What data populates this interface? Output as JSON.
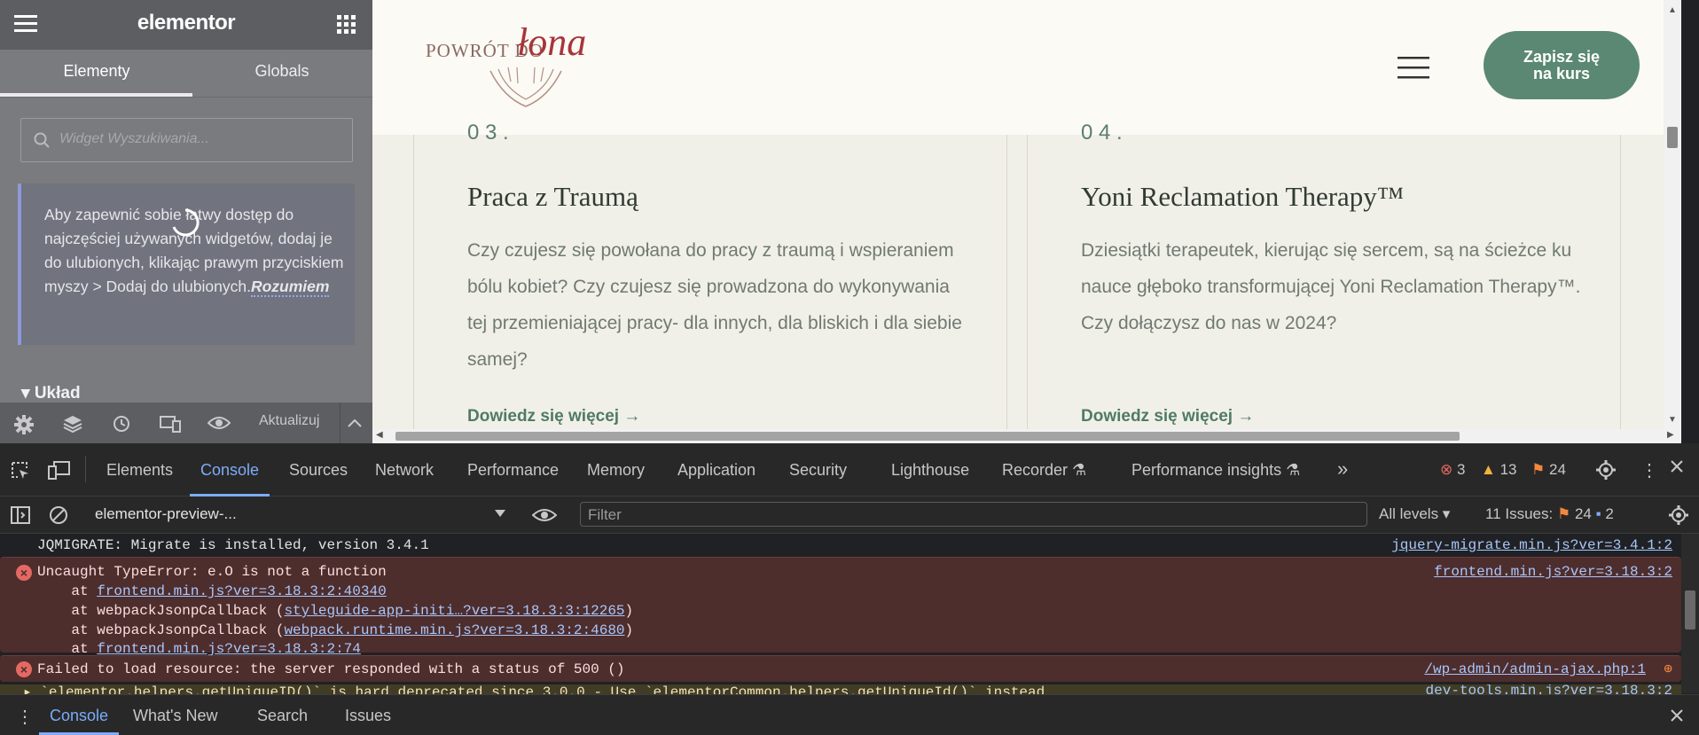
{
  "editor": {
    "logo": "elementor",
    "tabs": [
      "Elementy",
      "Globals"
    ],
    "search_placeholder": "Widget Wyszukiwania...",
    "notice_text": "Aby zapewnić sobie łatwy dostęp do najczęściej używanych widgetów, dodaj je do ulubionych, klikając prawym przyciskiem myszy > Dodaj do ulubionych.",
    "notice_link": "Rozumiem",
    "section_label": "▾ Układ",
    "update_label": "Aktualizuj"
  },
  "site": {
    "brand_small": "POWRÓT DO",
    "brand_script": "łona",
    "cta": [
      "Zapisz się",
      "na kurs"
    ],
    "cards": [
      {
        "num": "0 3 .",
        "title": "Praca z Traumą",
        "desc": "Czy czujesz się powołana do pracy z traumą i wspieraniem bólu kobiet? Czy czujesz się prowadzona do wykonywania tej przemieniającej pracy- dla innych, dla bliskich i dla siebie samej?",
        "link": "Dowiedz się więcej"
      },
      {
        "num": "0 4 .",
        "title": "Yoni Reclamation Therapy™",
        "desc": "Dziesiątki terapeutek, kierując się sercem, są na ścieżce ku nauce głęboko transformującej Yoni Reclamation Therapy™. Czy dołączysz do nas w 2024?",
        "link": "Dowiedz się więcej"
      }
    ]
  },
  "devtools": {
    "tabs": [
      "Elements",
      "Console",
      "Sources",
      "Network",
      "Performance",
      "Memory",
      "Application",
      "Security",
      "Lighthouse",
      "Recorder",
      "Performance insights"
    ],
    "counts": {
      "errors": "3",
      "warnings": "13",
      "issues": "24"
    },
    "context": "elementor-preview-...",
    "filter_placeholder": "Filter",
    "levels": "All levels ▾",
    "issues_label": "11 Issues:",
    "issues_a": "24",
    "issues_b": "2",
    "log": {
      "l1": "JQMIGRATE: Migrate is installed, version 3.4.1",
      "l1_src": "jquery-migrate.min.js?ver=3.4.1:2",
      "e1": "Uncaught TypeError: e.O is not a function",
      "e1_src": "frontend.min.js?ver=3.18.3:2",
      "s1_pre": "    at ",
      "s1_link": "frontend.min.js?ver=3.18.3:2:40340",
      "s2_pre": "    at webpackJsonpCallback (",
      "s2_link": "styleguide-app-initi…?ver=3.18.3:3:12265",
      "s2_post": ")",
      "s3_pre": "    at webpackJsonpCallback (",
      "s3_link": "webpack.runtime.min.js?ver=3.18.3:2:4680",
      "s3_post": ")",
      "s4_pre": "    at ",
      "s4_link": "frontend.min.js?ver=3.18.3:2:74",
      "e2": "Failed to load resource: the server responded with a status of 500 ()",
      "e2_src": "/wp-admin/admin-ajax.php:1",
      "w1": "▸ `elementor.helpers.getUniqueID()` is hard deprecated since 3.0.0 - Use `elementorCommon.helpers.getUniqueId()` instead",
      "w1_src": "dev-tools.min.js?ver=3.18.3:2"
    },
    "drawer_tabs": [
      "Console",
      "What's New",
      "Search",
      "Issues"
    ]
  },
  "colors": {
    "accent_green": "#5a8872",
    "devtools_blue": "#7cacf8",
    "error_bg": "#4e2d2d"
  }
}
